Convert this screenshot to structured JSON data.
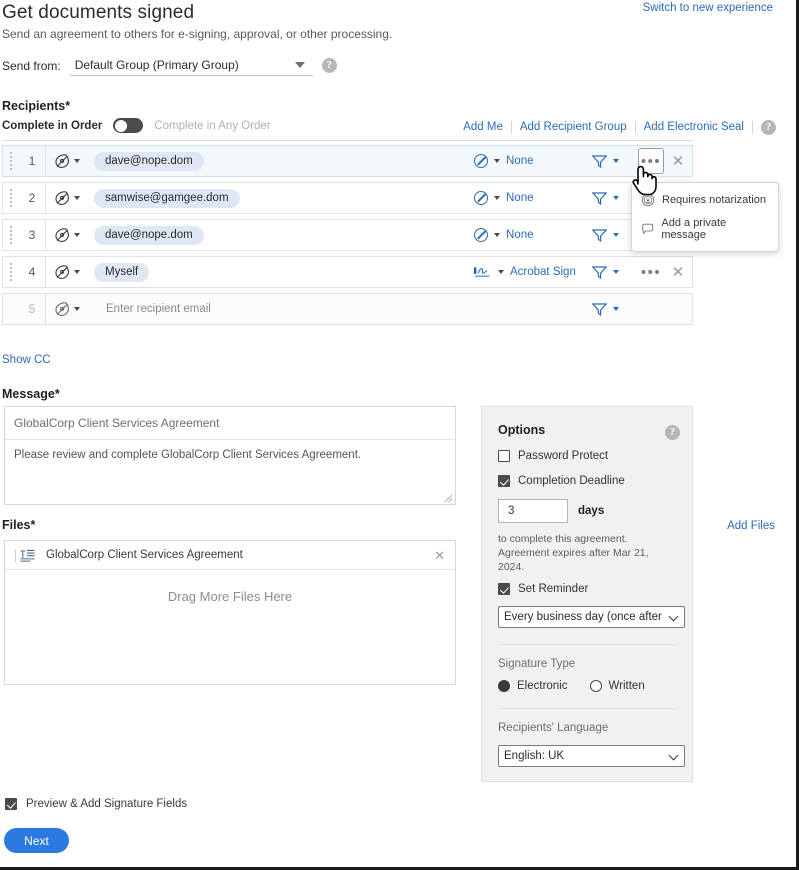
{
  "header": {
    "title": "Get documents signed",
    "subtitle": "Send an agreement to others for e-signing, approval, or other processing.",
    "switch_link": "Switch to new experience",
    "send_from_label": "Send from:",
    "send_from_value": "Default Group (Primary Group)",
    "help_glyph": "?"
  },
  "recipients": {
    "section_title": "Recipients",
    "required_mark": "*",
    "complete_in_order_label": "Complete in Order",
    "complete_in_any_order_label": "Complete in Any Order",
    "toggle_state": "off",
    "links": {
      "add_me": "Add Me",
      "add_recipient_group": "Add Recipient Group",
      "add_electronic_seal": "Add Electronic Seal"
    },
    "rows": [
      {
        "num": "1",
        "value": "dave@nope.dom",
        "role": "None",
        "role_icon": "no-entry-icon",
        "state": "active"
      },
      {
        "num": "2",
        "value": "samwise@gamgee.dom",
        "role": "None",
        "role_icon": "no-entry-icon",
        "state": "normal"
      },
      {
        "num": "3",
        "value": "dave@nope.dom",
        "role": "None",
        "role_icon": "no-entry-icon",
        "state": "normal"
      },
      {
        "num": "4",
        "value": "Myself",
        "role": "Acrobat Sign",
        "role_icon": "signature-icon",
        "state": "normal"
      },
      {
        "num": "5",
        "value": "",
        "placeholder": "Enter recipient email",
        "role": "",
        "role_icon": "",
        "state": "empty"
      }
    ],
    "more_glyph": "•••",
    "close_glyph": "✕",
    "context_menu": {
      "items": [
        {
          "label": "Requires notarization",
          "icon": "notary-stamp-icon"
        },
        {
          "label": "Add a private message",
          "icon": "comment-bubble-icon"
        }
      ]
    },
    "show_cc": "Show CC"
  },
  "message": {
    "section_title": "Message",
    "required_mark": "*",
    "subject": "GlobalCorp Client Services Agreement",
    "body": "Please review and complete GlobalCorp Client Services Agreement."
  },
  "files": {
    "section_title": "Files",
    "required_mark": "*",
    "add_files_link": "Add Files",
    "items": [
      {
        "name": "GlobalCorp Client Services Agreement"
      }
    ],
    "drop_text": "Drag More Files Here",
    "close_glyph": "✕"
  },
  "options": {
    "title": "Options",
    "password_protect": {
      "label": "Password Protect",
      "checked": false
    },
    "completion_deadline": {
      "label": "Completion Deadline",
      "checked": true
    },
    "days_value": "3",
    "days_unit": "days",
    "note_line1": "to complete this agreement.",
    "note_line2": "Agreement expires after Mar 21, 2024.",
    "set_reminder": {
      "label": "Set Reminder",
      "checked": true
    },
    "reminder_frequency": "Every business day (once after",
    "signature_type_label": "Signature Type",
    "signature_electronic": {
      "label": "Electronic",
      "selected": true
    },
    "signature_written": {
      "label": "Written",
      "selected": false
    },
    "language_label": "Recipients' Language",
    "language_value": "English: UK"
  },
  "footer": {
    "preview_label": "Preview & Add Signature Fields",
    "preview_checked": true,
    "next_label": "Next"
  },
  "colors": {
    "link_blue": "#2d6cb5",
    "button_blue": "#2a7ae0",
    "chip_blue": "#dfe7f5",
    "panel_gray": "#f1f1f1"
  }
}
